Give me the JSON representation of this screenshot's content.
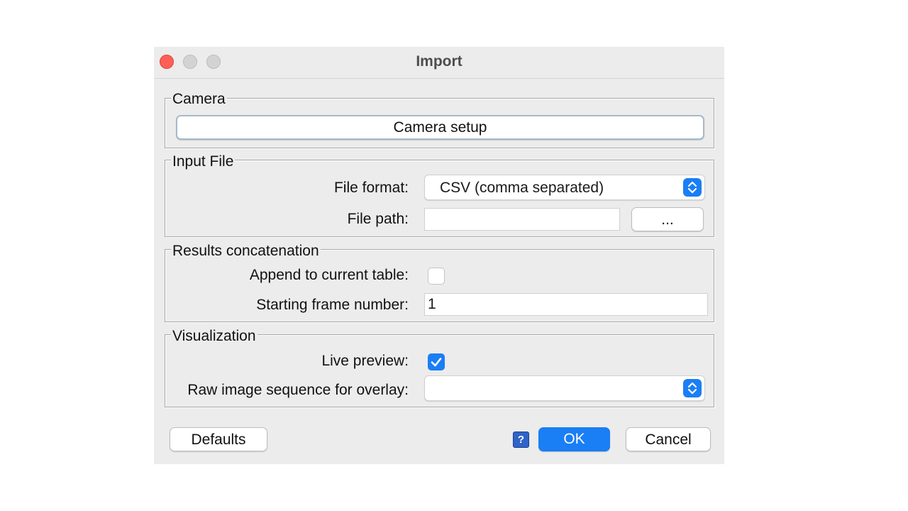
{
  "window": {
    "title": "Import"
  },
  "camera": {
    "legend": "Camera",
    "setup_label": "Camera setup"
  },
  "input_file": {
    "legend": "Input File",
    "format_label": "File format:",
    "format_value": "CSV (comma separated)",
    "path_label": "File path:",
    "path_value": "",
    "browse_label": "..."
  },
  "concatenation": {
    "legend": "Results concatenation",
    "append_label": "Append to current table:",
    "append_checked": false,
    "start_frame_label": "Starting frame number:",
    "start_frame_value": "1"
  },
  "visualization": {
    "legend": "Visualization",
    "live_preview_label": "Live preview:",
    "live_preview_checked": true,
    "overlay_label": "Raw image sequence for overlay:",
    "overlay_value": ""
  },
  "footer": {
    "defaults_label": "Defaults",
    "help_label": "?",
    "ok_label": "OK",
    "cancel_label": "Cancel"
  },
  "colors": {
    "accent": "#1a7ef5",
    "close": "#fe5f57",
    "disabled_light": "#d0d0d0"
  }
}
